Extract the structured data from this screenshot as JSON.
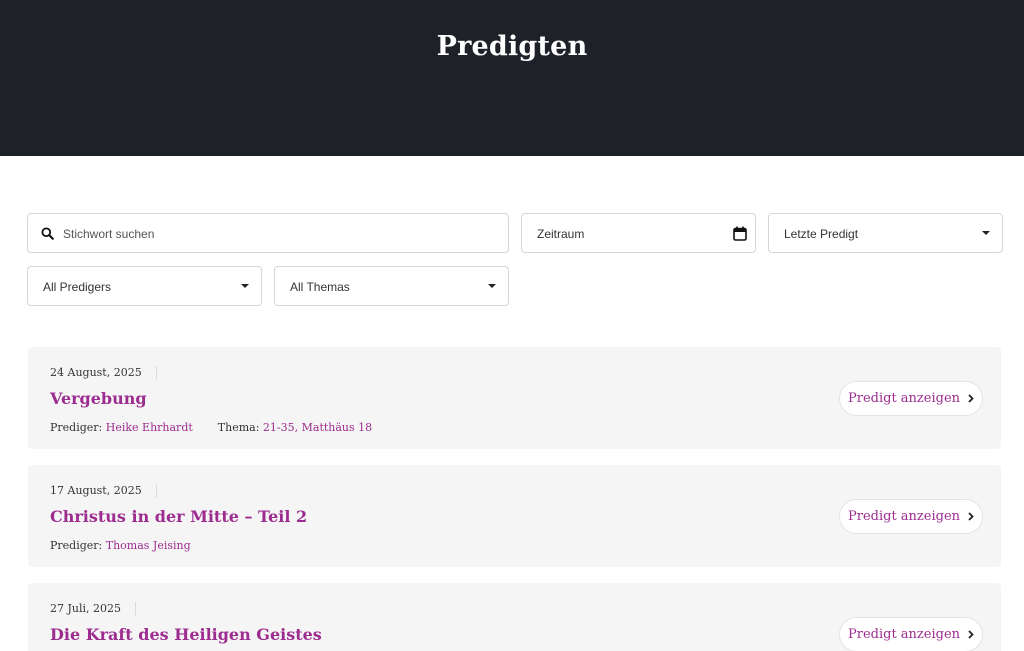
{
  "header": {
    "title": "Predigten"
  },
  "filters": {
    "search_placeholder": "Stichwort suchen",
    "date_range_label": "Zeitraum",
    "sort_label": "Letzte Predigt",
    "preacher_label": "All Predigers",
    "topic_label": "All Themas"
  },
  "sermons": [
    {
      "date": "24 August, 2025",
      "title": "Vergebung",
      "preacher_label": "Prediger:",
      "preacher": "Heike Ehrhardt",
      "topic_label": "Thema:",
      "topic": "21-35, Matthäus 18",
      "button": "Predigt anzeigen"
    },
    {
      "date": "17 August, 2025",
      "title": "Christus in der Mitte – Teil 2",
      "preacher_label": "Prediger:",
      "preacher": "Thomas Jeising",
      "button": "Predigt anzeigen"
    },
    {
      "date": "27 Juli, 2025",
      "title": "Die Kraft des Heiligen Geistes",
      "button": "Predigt anzeigen"
    }
  ],
  "colors": {
    "header_bg": "#1e2228",
    "accent": "#9c2c8f",
    "card_bg": "#f5f5f5"
  },
  "icons": {
    "search": "search-icon",
    "calendar": "calendar-icon",
    "dropdown": "chevron-down-icon",
    "button": "chevron-right-icon"
  }
}
